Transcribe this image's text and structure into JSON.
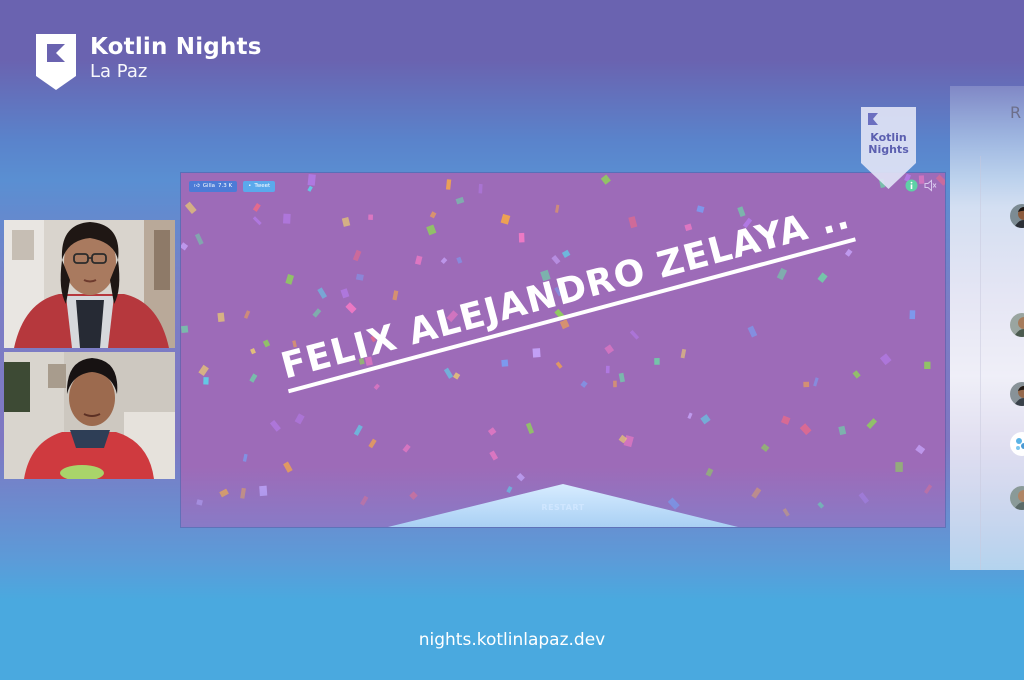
{
  "brand": {
    "title": "Kotlin Nights",
    "subtitle": "La Paz",
    "logo_icon": "kotlin-k-badge-icon"
  },
  "pin": {
    "line1": "Kotlin",
    "line2": "Nights"
  },
  "stage": {
    "winner_name": "FELIX ALEJANDRO ZELAYA ..",
    "restart_label": "RESTART",
    "social": {
      "like_label": "Gilla",
      "like_count": "7.3 K",
      "tweet_label": "Tweet"
    },
    "icons": [
      "info-icon",
      "speaker-icon"
    ],
    "background_color": "#9d6bb8"
  },
  "participants": {
    "video_tiles": [
      "participant-video-1",
      "participant-video-2"
    ]
  },
  "right_panel": {
    "header_letter": "R"
  },
  "footer": {
    "url": "nights.kotlinlapaz.dev"
  },
  "colors": {
    "top_purple": "#6a63b0",
    "bottom_blue": "#4aa9df",
    "stage_purple": "#9d6bb8"
  }
}
